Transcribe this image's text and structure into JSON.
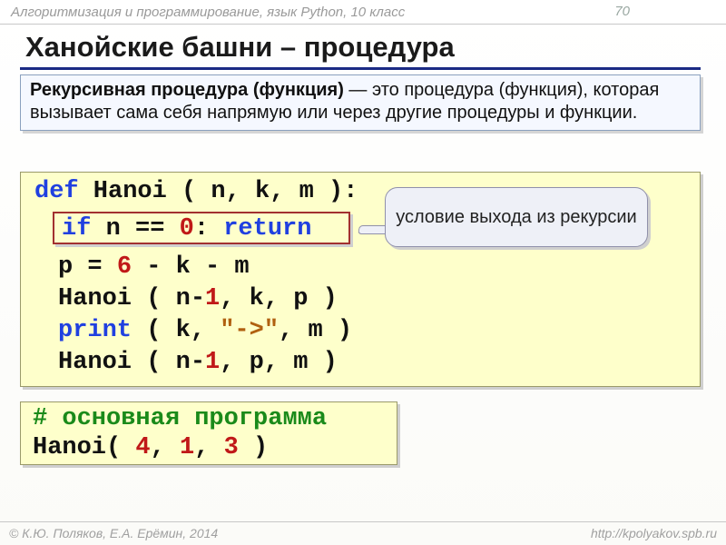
{
  "header": {
    "course": "Алгоритмизация и программирование, язык Python, 10 класс",
    "pagenum": "70"
  },
  "title": "Ханойские башни – процедура",
  "definition": {
    "term": "Рекурсивная процедура (функция)",
    "body": " — это процедура (функция), которая вызывает сама себя напрямую или через другие процедуры и функции."
  },
  "callout": "условие выхода из рекурсии",
  "code1": {
    "def": "def",
    "sig_a": " Hanoi ( n, k, m ):",
    "if_kw": "if",
    "if_cond_a": " n == ",
    "zero": "0",
    "colon": ": ",
    "ret": "return",
    "p_a": "p = ",
    "six": "6",
    "p_b": " - k - m",
    "h1_a": "Hanoi ( n-",
    "one": "1",
    "h1_b": ", k, p )",
    "print": "print",
    "pr_a": " ( k, ",
    "arrow": "\"->\"",
    "pr_b": ", m )",
    "h2_a": "Hanoi ( n-",
    "h2_b": ", p, m )"
  },
  "code2": {
    "comment": "# основная программа",
    "call_a": "Hanoi( ",
    "four": "4",
    "sep1": ", ",
    "one": "1",
    "sep2": ", ",
    "three": "3",
    "call_b": " )"
  },
  "footer": {
    "left": "© К.Ю. Поляков, Е.А. Ерёмин, 2014",
    "right": "http://kpolyakov.spb.ru"
  }
}
